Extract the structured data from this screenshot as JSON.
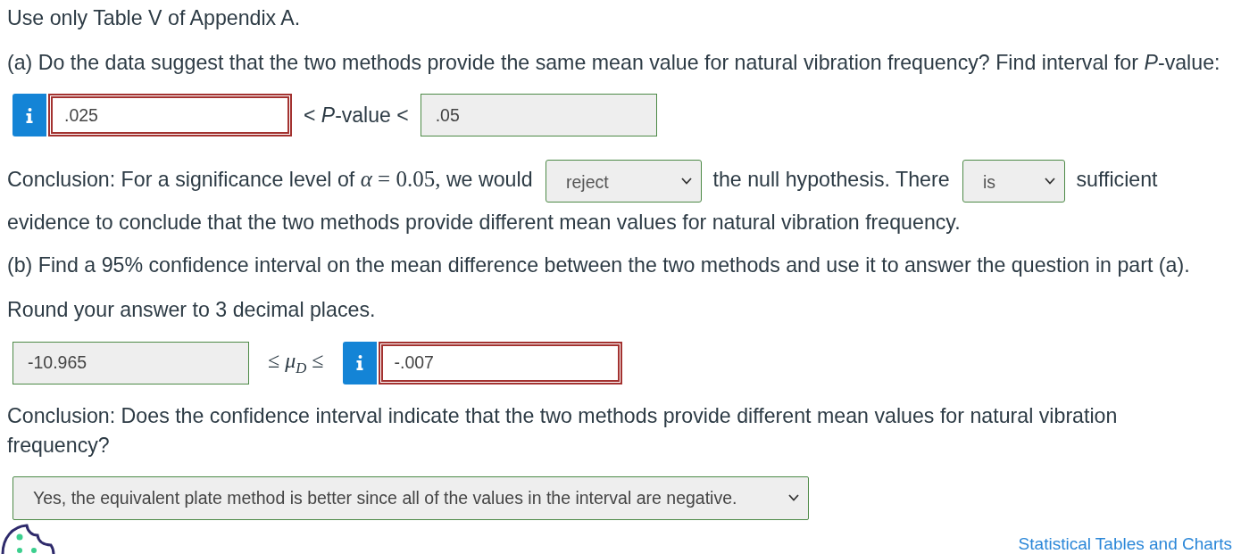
{
  "instruction": "Use only Table V of Appendix A.",
  "part_a": {
    "question": "(a) Do the data suggest that the two methods provide the same mean value for natural vibration frequency? Find interval for *P*-value:",
    "interval": {
      "lower": {
        "value": ".025",
        "correct": false
      },
      "between": {
        "kind": "text",
        "text": "< *P*-value <"
      },
      "upper": {
        "value": ".05",
        "correct": true
      }
    },
    "conclusion": [
      {
        "kind": "text",
        "text": "Conclusion: For a significance level of"
      },
      {
        "kind": "math",
        "text": "*α* = 0.05,"
      },
      {
        "kind": "text",
        "text": "we would"
      },
      {
        "kind": "dropdown",
        "value": "reject",
        "correct": true
      },
      {
        "kind": "text",
        "text": "the null hypothesis. There"
      },
      {
        "kind": "dropdown",
        "value": "is",
        "correct": true
      },
      {
        "kind": "text",
        "text": "sufficient"
      },
      {
        "kind": "text",
        "text": "evidence to conclude that the two methods provide different mean values for natural vibration frequency."
      }
    ]
  },
  "part_b": {
    "question": "(b) Find a 95% confidence interval on the mean difference between the two methods and use it to answer the question in part (a).",
    "instruction": "Round your answer to 3 decimal places.",
    "interval": {
      "lower": {
        "value": "-10.965",
        "correct": true
      },
      "between": {
        "kind": "math",
        "text": "≤ *μ*$_{D}$ ≤"
      },
      "upper": {
        "value": "-.007",
        "correct": false
      }
    },
    "conclusion_question": "Conclusion: Does the confidence interval indicate that the two methods provide different mean values for natural vibration frequency?",
    "answer": {
      "value": "Yes, the equivalent plate method is better since all of the values in the interval are negative.",
      "correct": true
    }
  },
  "footer": {
    "link": "Statistical Tables and Charts"
  }
}
